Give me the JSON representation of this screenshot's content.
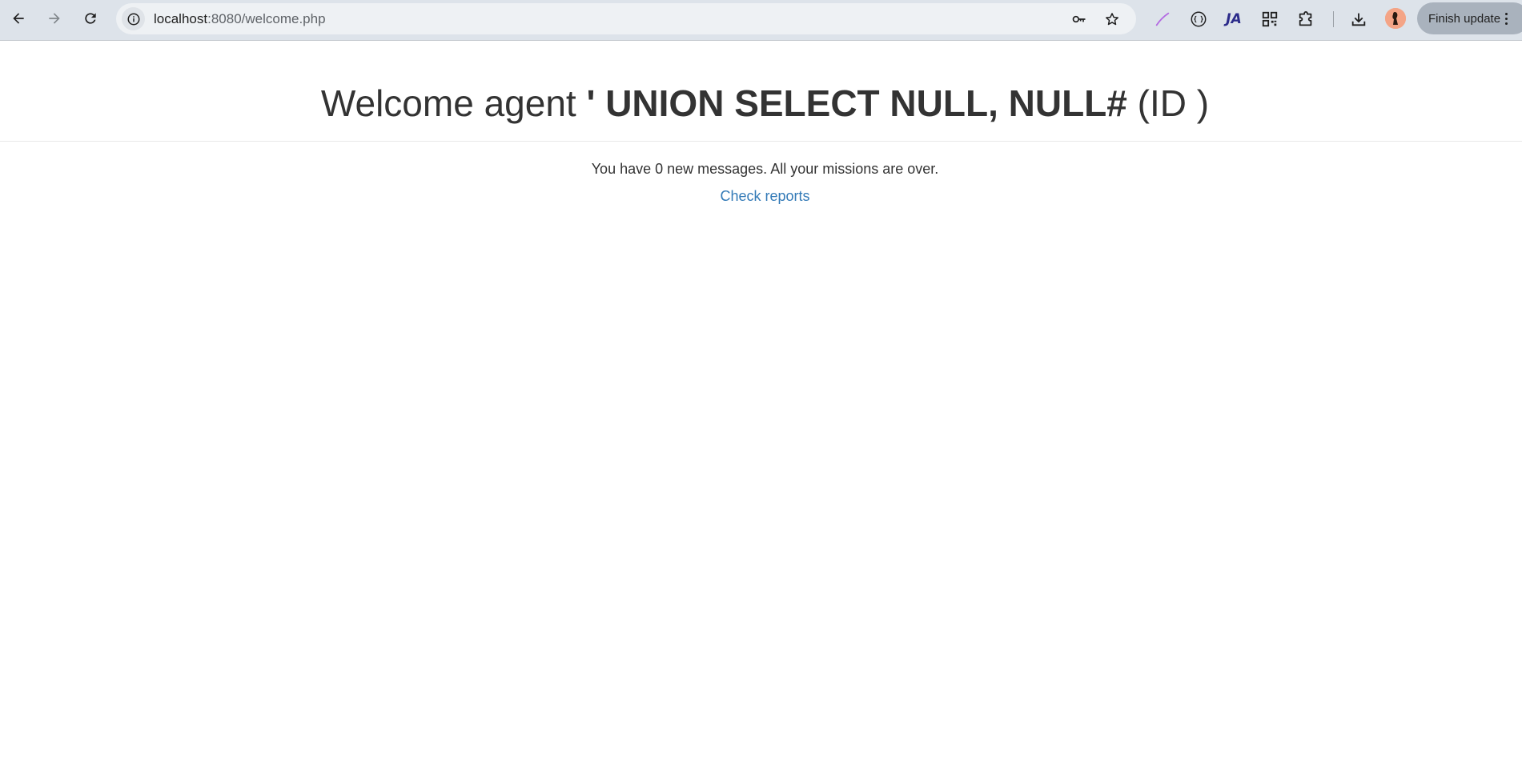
{
  "browser": {
    "url_host": "localhost",
    "url_rest": ":8080/welcome.php",
    "finish_update_label": "Finish update",
    "icons": {
      "back": "arrow-left-icon",
      "forward": "arrow-right-icon",
      "reload": "reload-icon",
      "site_info": "info-icon",
      "password": "key-icon",
      "bookmark": "star-icon",
      "ext_pen": "pen-extension-icon",
      "ext_braces": "braces-extension-icon",
      "ext_ja": "ja-extension-icon",
      "ext_qr": "qr-code-extension-icon",
      "extensions": "puzzle-icon",
      "downloads": "download-icon",
      "menu": "more-vertical-icon"
    },
    "ext_ja_text": "JA"
  },
  "page": {
    "welcome_prefix": "Welcome agent ",
    "agent_name": "' UNION SELECT NULL, NULL#",
    "id_text": " (ID )",
    "messages": "You have 0 new messages. All your missions are over.",
    "reports_link": "Check reports"
  },
  "colors": {
    "toolbar_bg": "#dde3ea",
    "link": "#337ab7",
    "text": "#333333"
  }
}
